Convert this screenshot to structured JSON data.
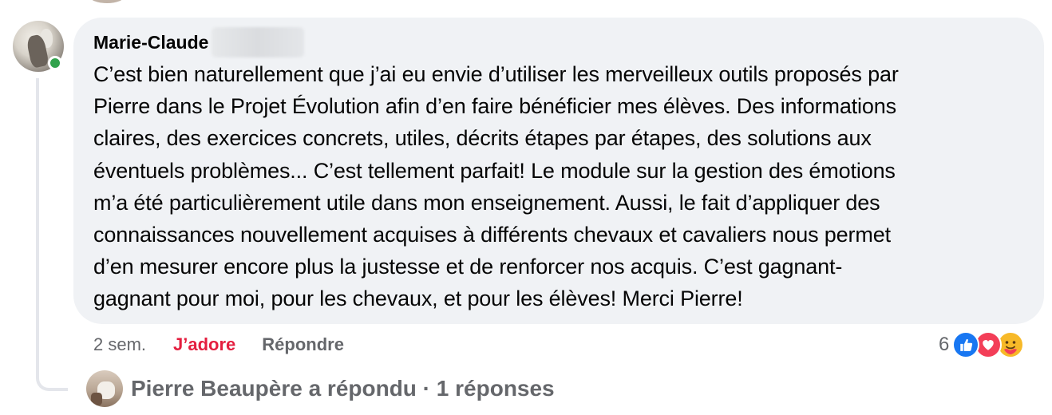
{
  "comment": {
    "author_first_name": "Marie-Claude",
    "text": "C’est bien naturellement que j’ai eu envie d’utiliser les merveilleux outils proposés par\nPierre dans le Projet Évolution afin d’en faire bénéficier mes élèves. Des informations\nclaires, des exercices concrets, utiles, décrits étapes par étapes, des solutions aux\néventuels problèmes... C’est tellement parfait! Le module sur la gestion des émotions\nm’a été particulièrement utile dans mon enseignement. Aussi, le fait d’appliquer des\nconnaissances nouvellement acquises à différents chevaux et cavaliers nous permet\nd’en mesurer encore plus la justesse et de renforcer nos acquis. C’est gagnant-\ngagnant pour moi, pour les chevaux, et pour les élèves! Merci Pierre!",
    "online": true
  },
  "actions": {
    "time": "2 sem.",
    "love_label": "J’adore",
    "reply_label": "Répondre"
  },
  "reactions": {
    "count": "6",
    "types": [
      "like-icon",
      "love-icon",
      "care-icon"
    ]
  },
  "replies": {
    "label": "Pierre Beaupère a répondu · 1 réponses"
  },
  "colors": {
    "bubble": "#f0f2f5",
    "text": "#050505",
    "secondary": "#65676b",
    "love_red": "#e41e3f",
    "like_blue": "#1877f2",
    "online_green": "#31a24c"
  }
}
